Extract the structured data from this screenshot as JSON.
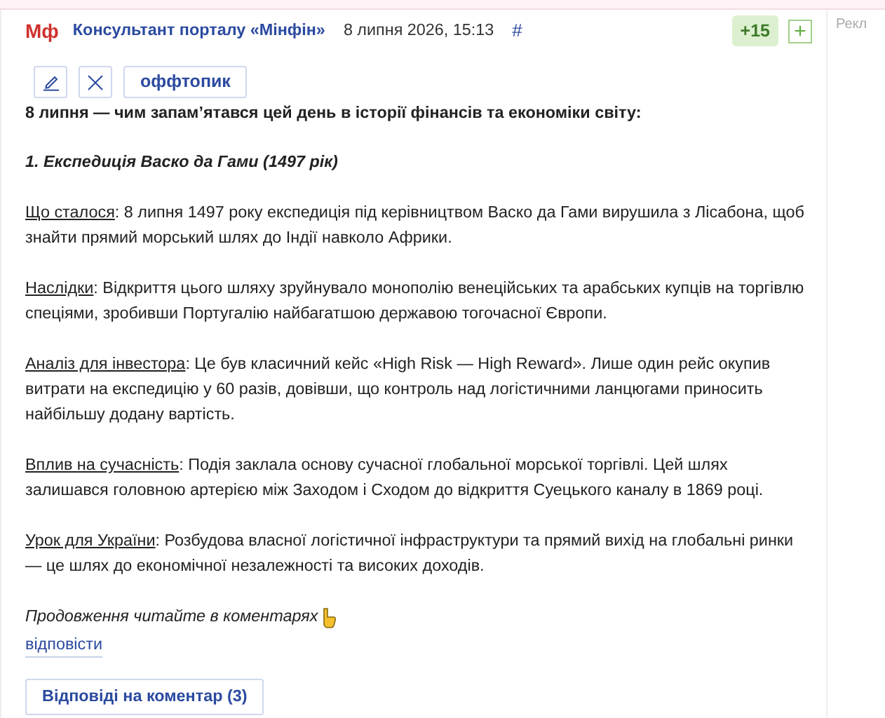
{
  "sidebar": {
    "label": "Рекл"
  },
  "comment": {
    "logo": "Мф",
    "author": "Консультант порталу «Мінфін»",
    "date": "8 липня 2026, 15:13",
    "anchor": "#",
    "score": "+15",
    "vote_plus": "+",
    "tools": [
      {
        "kind": "edit"
      },
      {
        "kind": "delete"
      },
      {
        "kind": "tag",
        "label": "оффтопик"
      }
    ],
    "title": "8 липня — чим запам’ятався цей день в історії фінансів та економіки світу:",
    "heading": "1. Експедиція Васко да Гами (1497 рік)",
    "sections": [
      {
        "label": "Що сталося",
        "text": ": 8 липня 1497 року експедиція під керівництвом Васко да Гами вирушила з Лісабона, щоб знайти прямий морський шлях до Індії навколо Африки."
      },
      {
        "label": "Наслідки",
        "text": ": Відкриття цього шляху зруйнувало монополію венеційських та арабських купців на торгівлю спеціями, зробивши Португалію найбагатшою державою тогочасної Європи."
      },
      {
        "label": "Аналіз для інвестора",
        "text": ": Це був класичний кейс «High Risk — High Reward». Лише один рейс окупив витрати на експедицію у 60 разів, довівши, що контроль над логістичними ланцюгами приносить найбільшу додану вартість."
      },
      {
        "label": "Вплив на сучасність",
        "text": ": Подія заклала основу сучасної глобальної морської торгівлі. Цей шлях залишався головною артерією між Заходом і Сходом до відкриття Суецького каналу в 1869 році."
      },
      {
        "label": "Урок для України",
        "text": ": Розбудова власної логістичної інфраструктури та прямий вихід на глобальні ринки — це шлях до економічної незалежності та високих доходів."
      }
    ],
    "continuation": "Продовження читайте в коментарях",
    "reply_link": "відповісти",
    "replies_button": "Відповіді на коментар (3)"
  }
}
